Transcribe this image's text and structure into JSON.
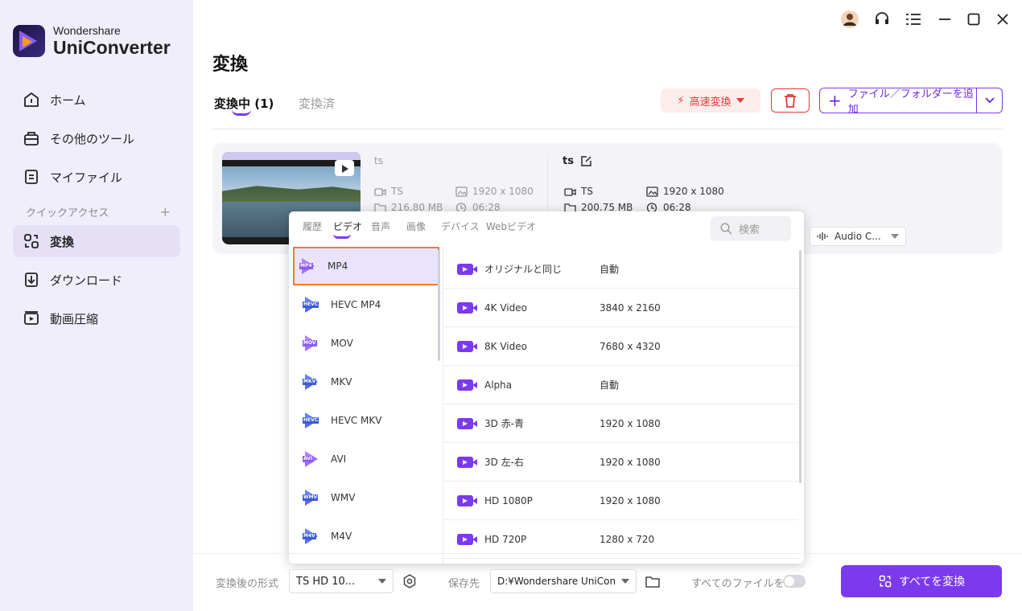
{
  "app": {
    "brand_line1": "Wondershare",
    "brand_line2": "UniConverter"
  },
  "sidebar": {
    "items": [
      {
        "label": "ホーム"
      },
      {
        "label": "その他のツール"
      },
      {
        "label": "マイファイル"
      },
      {
        "label": "変換"
      },
      {
        "label": "ダウンロード"
      },
      {
        "label": "動画圧縮"
      }
    ],
    "quick_access": "クイックアクセス",
    "quick_access_add": "+"
  },
  "main": {
    "title": "変換",
    "tabs": [
      {
        "label": "変換中 (1)"
      },
      {
        "label": "変換済"
      }
    ],
    "fast_convert": "高速変換",
    "add_files": "ファイル／フォルダーを追加"
  },
  "file": {
    "source": {
      "name": "ts",
      "format": "TS",
      "resolution": "1920 x 1080",
      "size": "216.80 MB",
      "duration": "06:28"
    },
    "output": {
      "name": "ts",
      "format": "TS",
      "resolution": "1920 x 1080",
      "size": "200.75 MB",
      "duration": "06:28"
    },
    "audio": "Audio C..."
  },
  "format_popup": {
    "tabs": [
      "履歴",
      "ビデオ",
      "音声",
      "画像",
      "デバイス",
      "Webビデオ"
    ],
    "active_tab": "ビデオ",
    "search_placeholder": "検索",
    "formats": [
      {
        "label": "MP4",
        "icon": "MP4"
      },
      {
        "label": "HEVC MP4",
        "icon": "HEVC"
      },
      {
        "label": "MOV",
        "icon": "MOV"
      },
      {
        "label": "MKV",
        "icon": "MKV"
      },
      {
        "label": "HEVC MKV",
        "icon": "HEVC"
      },
      {
        "label": "AVI",
        "icon": "AVI"
      },
      {
        "label": "WMV",
        "icon": "WMV"
      },
      {
        "label": "M4V",
        "icon": "M4V"
      }
    ],
    "selected_format": "MP4",
    "qualities": [
      {
        "name": "オリジナルと同じ",
        "res": "自動"
      },
      {
        "name": "4K Video",
        "res": "3840 x 2160"
      },
      {
        "name": "8K Video",
        "res": "7680 x 4320"
      },
      {
        "name": "Alpha",
        "res": "自動"
      },
      {
        "name": "3D 赤-青",
        "res": "1920 x 1080"
      },
      {
        "name": "3D 左-右",
        "res": "1920 x 1080"
      },
      {
        "name": "HD 1080P",
        "res": "1920 x 1080"
      },
      {
        "name": "HD 720P",
        "res": "1280 x 720"
      }
    ]
  },
  "footer": {
    "output_format_label": "変換後の形式",
    "output_format_value": "TS HD 10...",
    "save_label": "保存先",
    "save_path": "D:¥Wondershare UniCon",
    "merge_label": "すべてのファイルを...",
    "convert_all": "すべてを変換"
  },
  "colors": {
    "accent": "#7c3aed",
    "danger": "#e53935",
    "sidebar_bg": "#f1eefb",
    "highlight": "#f07a3a"
  }
}
